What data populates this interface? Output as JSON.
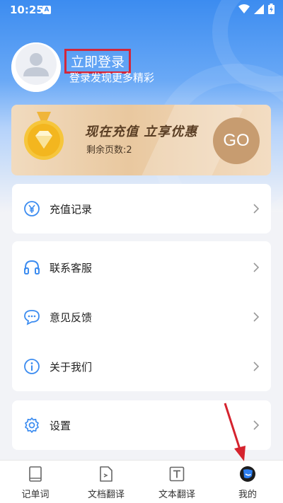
{
  "status_bar": {
    "time": "10:25",
    "notification_letter": "A"
  },
  "profile": {
    "login_label": "立即登录",
    "login_subtitle": "登录发现更多精彩"
  },
  "vip_banner": {
    "title": "现在充值 立享优惠",
    "remaining_label": "剩余页数:2",
    "go_label": "GO"
  },
  "menu": {
    "recharge": {
      "label": "充值记录",
      "icon": "yen-circle-icon"
    },
    "service": {
      "label": "联系客服",
      "icon": "headset-icon"
    },
    "feedback": {
      "label": "意见反馈",
      "icon": "chat-bubble-icon"
    },
    "about": {
      "label": "关于我们",
      "icon": "info-icon"
    },
    "settings": {
      "label": "设置",
      "icon": "gear-icon"
    }
  },
  "tabbar": {
    "tabs": [
      {
        "label": "记单词",
        "icon": "book-icon"
      },
      {
        "label": "文档翻译",
        "icon": "document-icon"
      },
      {
        "label": "文本翻译",
        "icon": "text-icon"
      },
      {
        "label": "我的",
        "icon": "profile-icon",
        "active": true
      }
    ]
  },
  "colors": {
    "accent": "#3c8cf0",
    "highlight_box": "#d2273b",
    "gold": "#c79c70",
    "annotation_arrow": "#d5232e"
  }
}
